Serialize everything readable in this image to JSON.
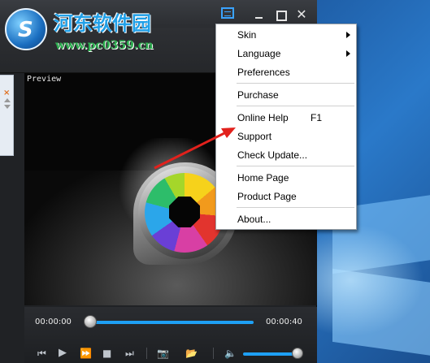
{
  "watermark": {
    "logo_glyph": "S",
    "name": "河东软件园",
    "url": "www.pc0359.cn"
  },
  "titlebar": {
    "menu_icon": "menu-icon",
    "minimize_icon": "minimize-icon",
    "maximize_icon": "maximize-icon",
    "close_glyph": "✕"
  },
  "sidepanel": {
    "close_glyph": "×"
  },
  "preview": {
    "label": "Preview"
  },
  "player": {
    "time_current": "00:00:00",
    "time_total": "00:00:40",
    "progress": 0.0,
    "volume": 1.0,
    "glyphs": {
      "prev": "⏮",
      "play": "▶",
      "fast_forward": "⏩",
      "stop": "■",
      "next": "⏭",
      "camera": "📷",
      "folder": "📂",
      "volume": "🔈"
    }
  },
  "menu": {
    "items": [
      {
        "label": "Skin",
        "submenu": true
      },
      {
        "label": "Language",
        "submenu": true
      },
      {
        "label": "Preferences"
      },
      {
        "label": "Purchase"
      },
      {
        "label": "Online Help",
        "shortcut": "F1"
      },
      {
        "label": "Support"
      },
      {
        "label": "Check Update..."
      },
      {
        "label": "Home Page"
      },
      {
        "label": "Product Page"
      },
      {
        "label": "About..."
      }
    ]
  },
  "colors": {
    "accent": "#1ea0f5",
    "annotation": "#e2211c",
    "menu_icon": "#3aa3ff"
  }
}
